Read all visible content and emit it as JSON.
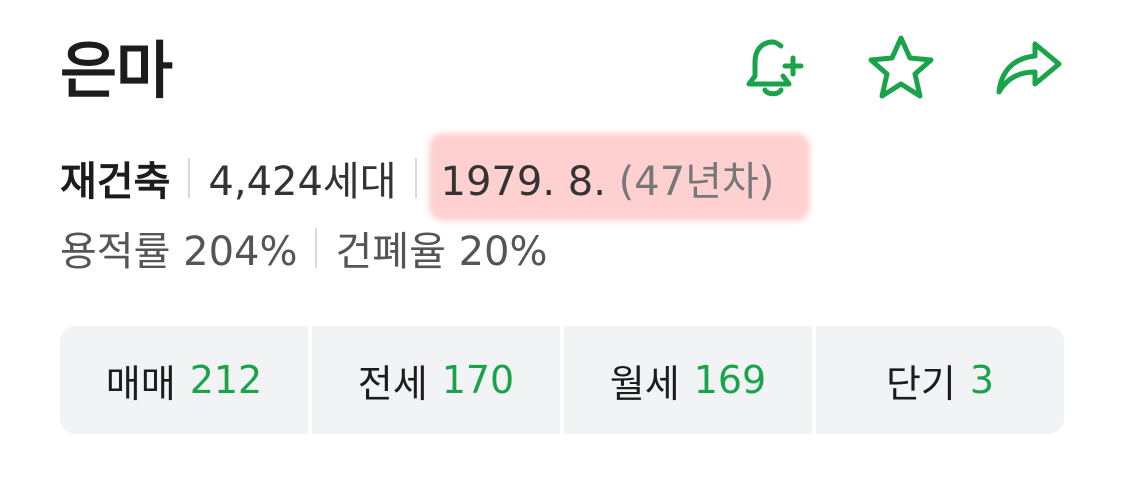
{
  "complex": {
    "name": "은마",
    "type": "재건축",
    "households": "4,424세대",
    "built_date": "1979. 8.",
    "age": "(47년차)",
    "floor_area_ratio": "용적률 204%",
    "building_coverage_ratio": "건폐율 20%"
  },
  "actions": {
    "notify_icon": "bell-plus-icon",
    "favorite_icon": "star-icon",
    "share_icon": "share-arrow-icon",
    "accent_color": "#19a34a"
  },
  "tabs": [
    {
      "label": "매매",
      "count": "212"
    },
    {
      "label": "전세",
      "count": "170"
    },
    {
      "label": "월세",
      "count": "169"
    },
    {
      "label": "단기",
      "count": "3"
    }
  ]
}
